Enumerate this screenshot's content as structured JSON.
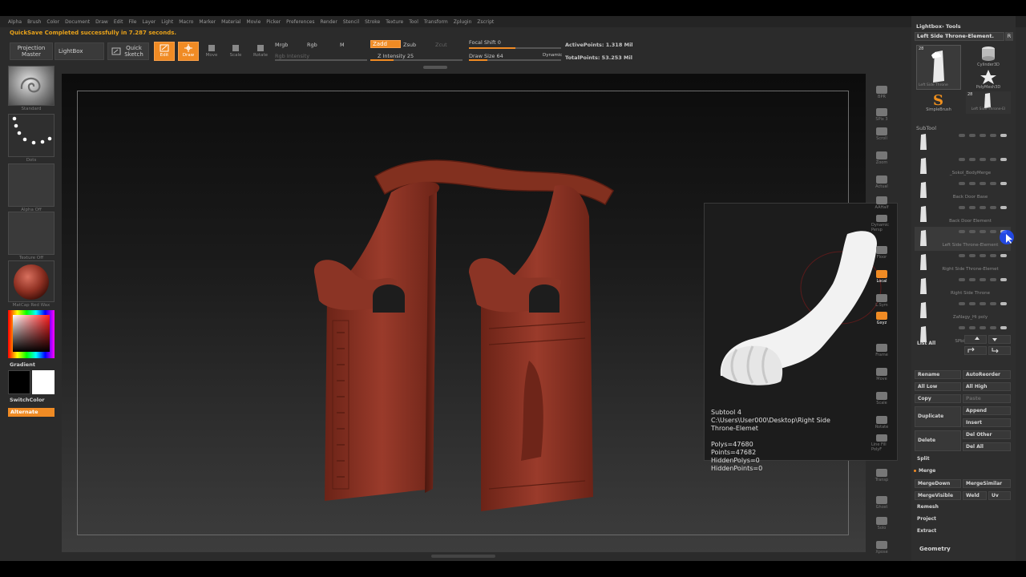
{
  "menu": [
    "Alpha",
    "Brush",
    "Color",
    "Document",
    "Draw",
    "Edit",
    "File",
    "Layer",
    "Light",
    "Macro",
    "Marker",
    "Material",
    "Movie",
    "Picker",
    "Preferences",
    "Render",
    "Stencil",
    "Stroke",
    "Texture",
    "Tool",
    "Transform",
    "Zplugin",
    "Zscript"
  ],
  "notice": "QuickSave Completed successfully in 7.287 seconds.",
  "toolbar": {
    "projection_master": "Projection Master",
    "lightbox": "LightBox",
    "quick_sketch": "Quick Sketch",
    "edit": "Edit",
    "draw": "Draw",
    "move": "Move",
    "scale": "Scale",
    "rotate": "Rotate",
    "mrgb": "Mrgb",
    "rgb": "Rgb",
    "m": "M",
    "rgb_intensity": "Rgb Intensity",
    "zadd": "Zadd",
    "zsub": "Zsub",
    "zcut": "Zcut",
    "z_intensity": "Z Intensity 25",
    "focal_shift": "Focal Shift 0",
    "draw_size": "Draw Size 64",
    "dynamic": "Dynamic",
    "active_points": "ActivePoints: 1.318 Mil",
    "total_points": "TotalPoints: 53.253 Mil",
    "z_intensity_level": 0.25,
    "focal_shift_level": 0.5,
    "draw_size_level": 0.2
  },
  "left_shelf": {
    "brush": "Standard",
    "stroke": "Dots",
    "alpha": "Alpha Off",
    "texture": "Texture Off",
    "material": "MatCap Red Wax",
    "gradient": "Gradient",
    "switch_color": "SwitchColor",
    "alternate": "Alternate"
  },
  "right_shelf": [
    {
      "label": "BPR",
      "active": false
    },
    {
      "label": "SPix 3",
      "active": false
    },
    {
      "label": "Scroll",
      "active": false
    },
    {
      "label": "Zoom",
      "active": false
    },
    {
      "label": "Actual",
      "active": false
    },
    {
      "label": "AAHalf",
      "active": false
    },
    {
      "label": "Dynamic Persp",
      "active": false
    },
    {
      "label": "Floor",
      "active": false
    },
    {
      "label": "Local",
      "active": true
    },
    {
      "label": "L.Sym",
      "active": false
    },
    {
      "label": "Gxyz",
      "active": true
    },
    {
      "label": "Frame",
      "active": false
    },
    {
      "label": "Move",
      "active": false
    },
    {
      "label": "Scale",
      "active": false
    },
    {
      "label": "Rotate",
      "active": false
    },
    {
      "label": "Line Fill PolyF",
      "active": false
    },
    {
      "label": "Transp",
      "active": false
    },
    {
      "label": "Ghost",
      "active": false
    },
    {
      "label": "Solo",
      "active": false
    },
    {
      "label": "Xpose",
      "active": false
    }
  ],
  "tooltip": {
    "title": "Subtool 4",
    "path_1": "C:\\Users\\User000\\Desktop\\Right Side",
    "path_2": "Throne-Elemet",
    "polys": "Polys=47680",
    "points": "Points=47682",
    "hidden_polys": "HiddenPolys=0",
    "hidden_points": "HiddenPoints=0"
  },
  "tray": {
    "lightbox_tools": "Lightbox› Tools",
    "current_tool": "Left Side Throne-Element.",
    "r_button": "R",
    "tool_count": "28",
    "tool_count_2": "28",
    "tools": [
      "Left Side Throne",
      "Cylinder3D",
      "PolyMesh3D",
      "SimpleBrush",
      "Left Side Throne-El"
    ],
    "subtool_header": "SubTool",
    "subtools": [
      {
        "name": "",
        "selected": false
      },
      {
        "name": "_Sokol_BodyMerge",
        "selected": false
      },
      {
        "name": "Back Door Base",
        "selected": false
      },
      {
        "name": "Back Door Element",
        "selected": false
      },
      {
        "name": "Left Side Throne-Element",
        "selected": true
      },
      {
        "name": "Right Side Throne-Elemet",
        "selected": false
      },
      {
        "name": "Right Side Throne",
        "selected": false
      },
      {
        "name": "ZaNagy_Hi poly",
        "selected": false
      },
      {
        "name": "SPbika_Hipoly",
        "selected": false
      }
    ],
    "list_all": "List All",
    "rename": "Rename",
    "auto_reorder": "AutoReorder",
    "all_low": "All Low",
    "all_high": "All High",
    "copy": "Copy",
    "paste": "Paste",
    "append": "Append",
    "duplicate": "Duplicate",
    "insert": "Insert",
    "del_other": "Del Other",
    "delete": "Delete",
    "del_all": "Del All",
    "split": "Split",
    "merge": "Merge",
    "merge_down": "MergeDown",
    "merge_similar": "MergeSimilar",
    "merge_visible": "MergeVisible",
    "weld": "Weld",
    "uv": "Uv",
    "remesh": "Remesh",
    "project": "Project",
    "extract": "Extract",
    "geometry": "Geometry"
  },
  "colors": {
    "accent": "#f08b24",
    "model": "#8a3426",
    "notice": "#e8a21a"
  }
}
